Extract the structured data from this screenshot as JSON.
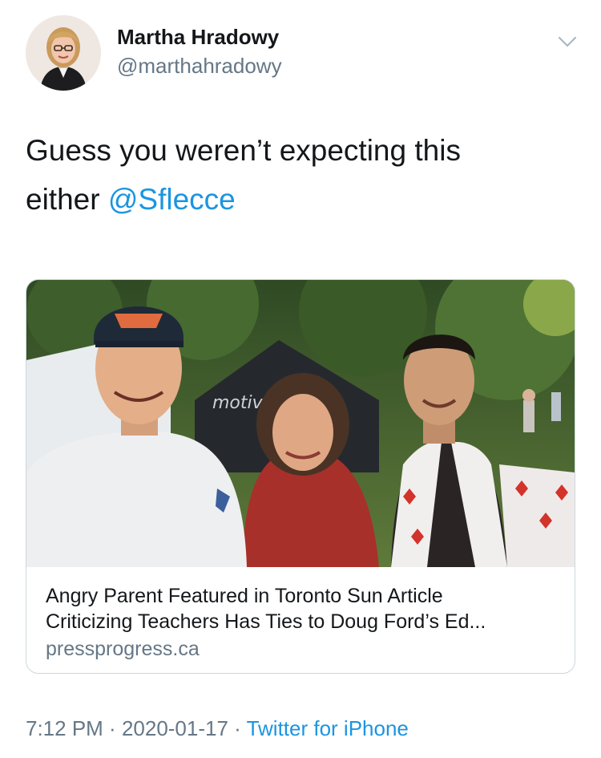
{
  "author": {
    "name": "Martha Hradowy",
    "handle": "@marthahradowy"
  },
  "tweet": {
    "text_before": "Guess you weren’t expecting this",
    "text_line2_before": "either ",
    "mention": "@Sflecce"
  },
  "card": {
    "title_line1": "Angry Parent Featured in Toronto Sun Article",
    "title_line2": "Criticizing Teachers Has Ties to Doug Ford’s Ed...",
    "domain": "pressprogress.ca",
    "image_text": "motiv"
  },
  "meta": {
    "time": "7:12 PM",
    "separator": " · ",
    "date": "2020-01-17",
    "source": "Twitter for iPhone"
  },
  "colors": {
    "link": "#1b95e0",
    "secondary": "#657786",
    "border": "#ccd6dd"
  },
  "icons": {
    "menu": "chevron-down-icon"
  }
}
